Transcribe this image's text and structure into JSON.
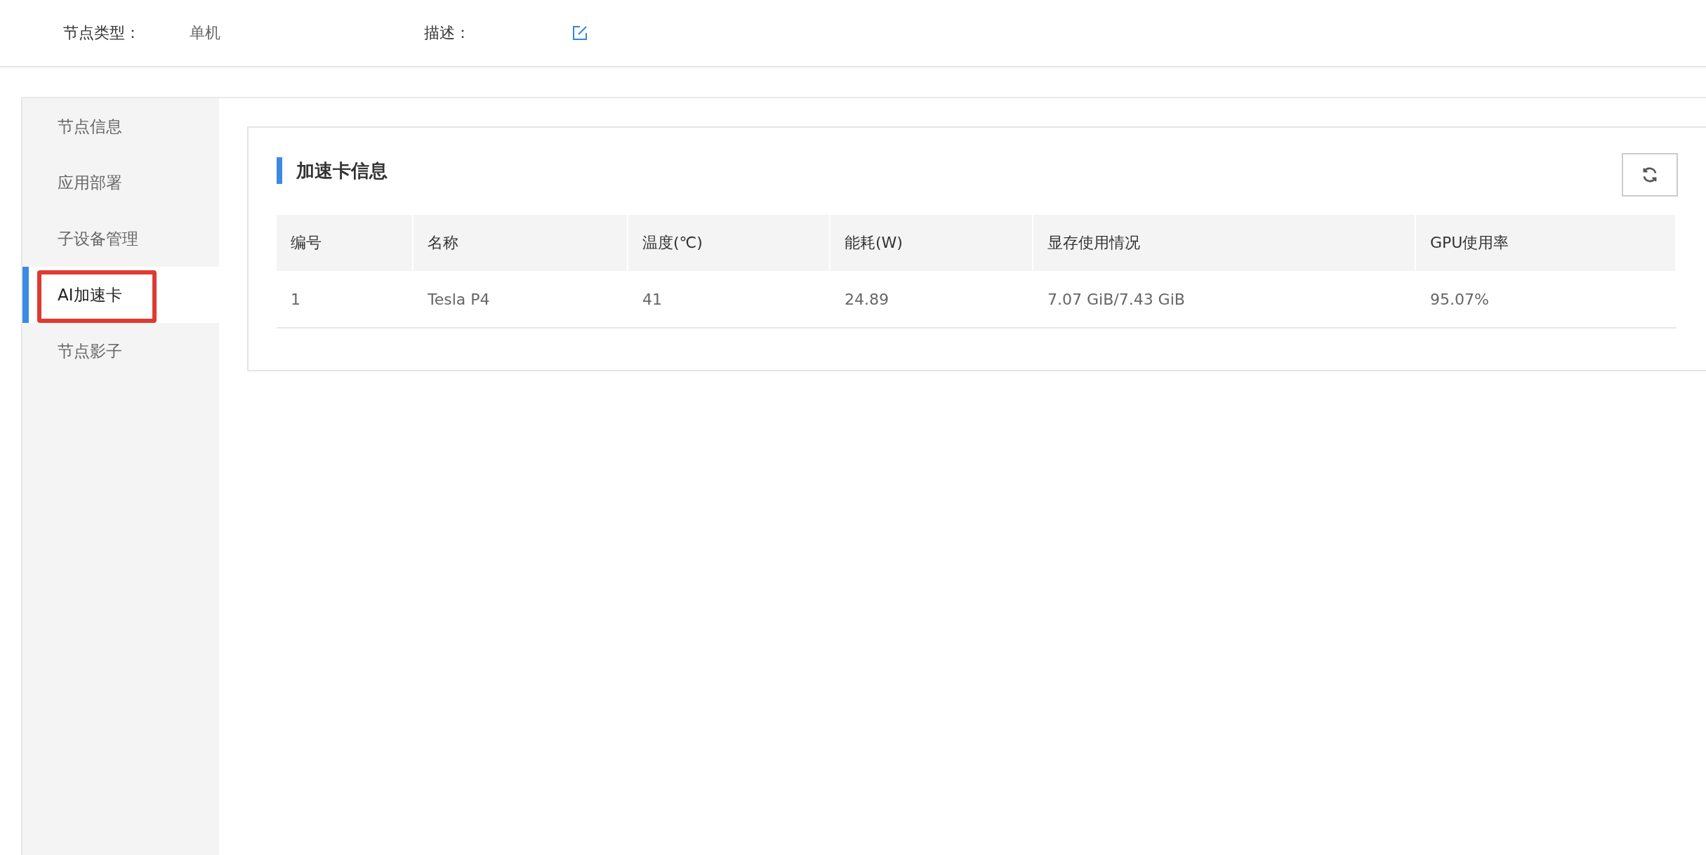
{
  "header": {
    "fields": [
      {
        "label": "节点类型：",
        "value": "单机",
        "kind": "text"
      },
      {
        "label": "描述：",
        "kind": "edit"
      }
    ]
  },
  "sidebar": {
    "items": [
      {
        "label": "节点信息",
        "selected": false,
        "highlighted": false
      },
      {
        "label": "应用部署",
        "selected": false,
        "highlighted": false
      },
      {
        "label": "子设备管理",
        "selected": false,
        "highlighted": false
      },
      {
        "label": "AI加速卡",
        "selected": true,
        "highlighted": true
      },
      {
        "label": "节点影子",
        "selected": false,
        "highlighted": false
      }
    ]
  },
  "card": {
    "title": "加速卡信息",
    "table": {
      "columns": [
        "编号",
        "名称",
        "温度(℃)",
        "能耗(W)",
        "显存使用情况",
        "GPU使用率"
      ],
      "rows": [
        [
          "1",
          "Tesla P4",
          "41",
          "24.89",
          "7.07 GiB/7.43 GiB",
          "95.07%"
        ]
      ]
    }
  }
}
